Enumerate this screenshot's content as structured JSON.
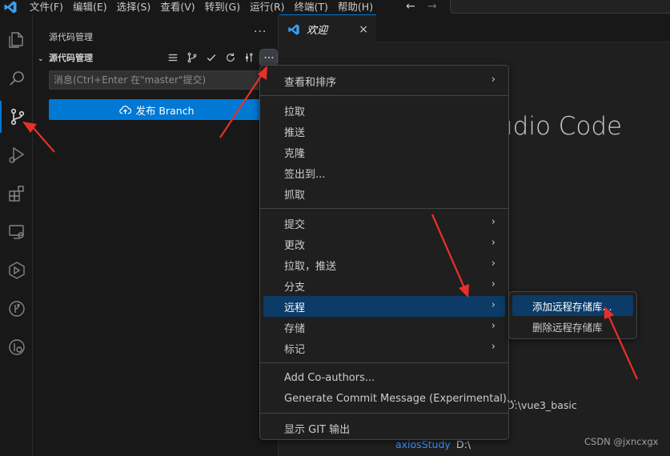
{
  "menubar": {
    "items": [
      "文件(F)",
      "编辑(E)",
      "选择(S)",
      "查看(V)",
      "转到(G)",
      "运行(R)",
      "终端(T)",
      "帮助(H)"
    ]
  },
  "nav": {
    "back": "←",
    "forward": "→"
  },
  "activitybar": {
    "items": [
      "explorer",
      "search",
      "source-control",
      "run-debug",
      "extensions",
      "remote-explorer",
      "testing",
      "git-graph",
      "gitlens"
    ],
    "active": "source-control"
  },
  "sidebar": {
    "title": "源代码管理",
    "more": "···",
    "section_title": "源代码管理",
    "section_chevron": "⌄",
    "toolbar": [
      "view-as-list",
      "branch",
      "commit",
      "refresh",
      "graph",
      "more-actions"
    ],
    "message_placeholder": "消息(Ctrl+Enter 在\"master\"提交)",
    "publish_label": "发布 Branch"
  },
  "editor": {
    "tab_label": "欢迎",
    "tab_close": "×",
    "welcome_title": "udio Code",
    "recent_path_1": "D:\\vue3_basic",
    "recent_name_2": "axiosStudy",
    "recent_path_2": "D:\\"
  },
  "context_menu": {
    "groups": [
      [
        {
          "label": "查看和排序",
          "submenu": true
        }
      ],
      [
        {
          "label": "拉取"
        },
        {
          "label": "推送"
        },
        {
          "label": "克隆"
        },
        {
          "label": "签出到..."
        },
        {
          "label": "抓取"
        }
      ],
      [
        {
          "label": "提交",
          "submenu": true
        },
        {
          "label": "更改",
          "submenu": true
        },
        {
          "label": "拉取，推送",
          "submenu": true
        },
        {
          "label": "分支",
          "submenu": true
        },
        {
          "label": "远程",
          "submenu": true
        },
        {
          "label": "存储",
          "submenu": true
        },
        {
          "label": "标记",
          "submenu": true
        }
      ],
      [
        {
          "label": "Add Co-authors..."
        },
        {
          "label": "Generate Commit Message (Experimental)..."
        }
      ],
      [
        {
          "label": "显示 GIT 输出"
        }
      ]
    ],
    "highlighted": "远程"
  },
  "submenu": {
    "items": [
      {
        "label": "添加远程存储库..."
      },
      {
        "label": "删除远程存储库"
      }
    ],
    "highlighted": "添加远程存储库..."
  },
  "watermark": "CSDN @jxncxgx",
  "colors": {
    "accent": "#0078d4",
    "annotation": "#e8302a",
    "link": "#3794ff"
  }
}
